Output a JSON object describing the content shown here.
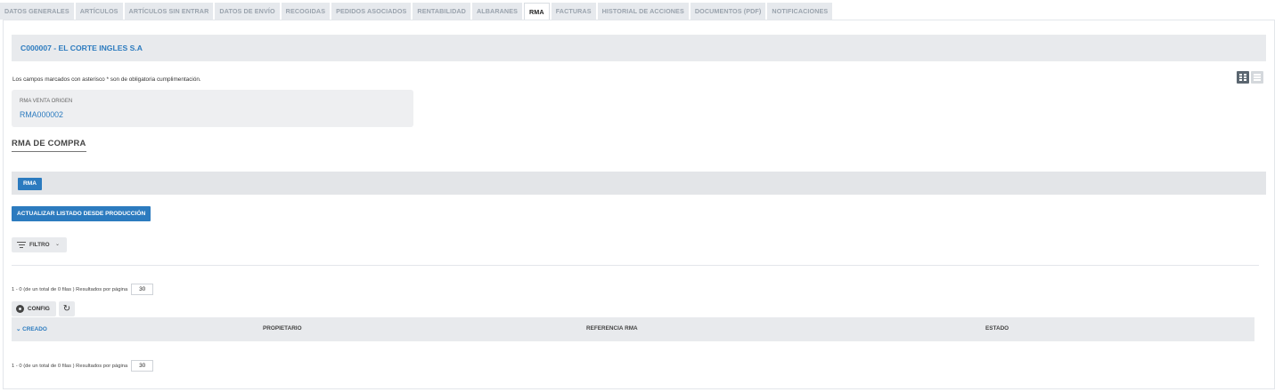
{
  "tabs": [
    {
      "label": "DATOS GENERALES",
      "active": false
    },
    {
      "label": "ARTÍCULOS",
      "active": false
    },
    {
      "label": "ARTÍCULOS SIN ENTRAR",
      "active": false
    },
    {
      "label": "DATOS DE ENVÍO",
      "active": false
    },
    {
      "label": "RECOGIDAS",
      "active": false
    },
    {
      "label": "PEDIDOS ASOCIADOS",
      "active": false
    },
    {
      "label": "RENTABILIDAD",
      "active": false
    },
    {
      "label": "ALBARANES",
      "active": false
    },
    {
      "label": "RMA",
      "active": true
    },
    {
      "label": "FACTURAS",
      "active": false
    },
    {
      "label": "HISTORIAL DE ACCIONES",
      "active": false
    },
    {
      "label": "DOCUMENTOS (PDF)",
      "active": false
    },
    {
      "label": "NOTIFICACIONES",
      "active": false
    }
  ],
  "client": {
    "title": "C000007 - EL CORTE INGLES S.A"
  },
  "required_note": "Los campos marcados con asterisco * son de obligatoria cumplimentación.",
  "view_toggle": {
    "grid_icon": "grid-view-icon",
    "list_icon": "list-view-icon"
  },
  "origin": {
    "label": "RMA VENTA ORIGEN",
    "value": "RMA000002"
  },
  "section": {
    "title": "RMA DE COMPRA"
  },
  "rma_bar": {
    "badge": "RMA"
  },
  "actions": {
    "update_label": "ACTUALIZAR LISTADO DESDE PRODUCCIÓN",
    "filter_label": "FILTRO",
    "filter_chevron": "⌄"
  },
  "pager": {
    "summary": "1 - 0 (de un total de 0 filas )  Resultados por página",
    "per_page": "30"
  },
  "pager_bottom": {
    "summary": "1 - 0 (de un total de 0 filas )  Resultados por página",
    "per_page": "30"
  },
  "table": {
    "config_label": "CONFIG",
    "refresh_glyph": "↻",
    "columns": [
      "⌄ CREADO",
      "PROPIETARIO",
      "REFERENCIA RMA",
      "ESTADO"
    ]
  },
  "colors": {
    "accent": "#2c7bbf",
    "bar_bg": "#e8eaed"
  }
}
